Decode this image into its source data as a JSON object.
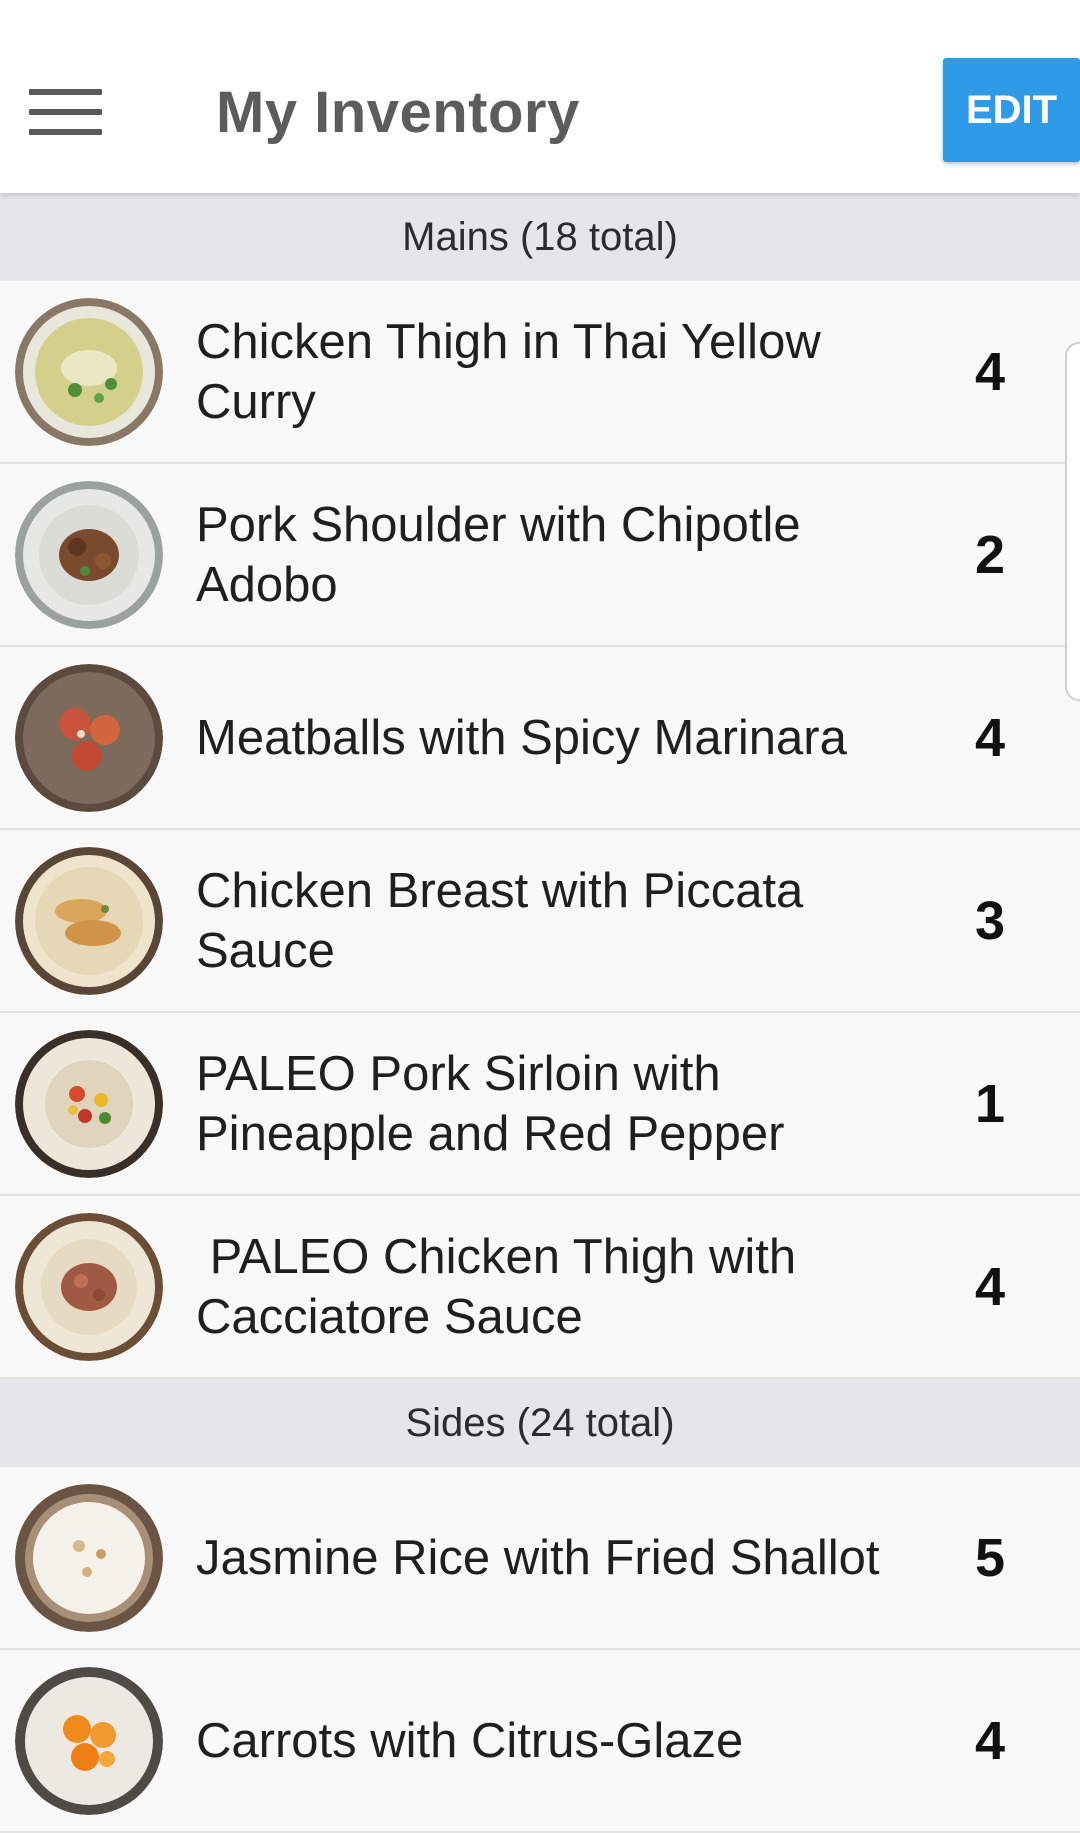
{
  "header": {
    "title": "My Inventory",
    "edit_label": "EDIT",
    "menu_icon": "hamburger-menu-icon"
  },
  "colors": {
    "accent": "#2d9be8",
    "section_bg": "#e5e6ea",
    "row_bg": "#f8f8f8"
  },
  "sections": [
    {
      "label": "Mains (18 total)",
      "items": [
        {
          "name": "Chicken Thigh in Thai Yellow\nCurry",
          "count": "4"
        },
        {
          "name": "Pork Shoulder with Chipotle\nAdobo",
          "count": "2"
        },
        {
          "name": "Meatballs with Spicy Marinara",
          "count": "4"
        },
        {
          "name": "Chicken Breast with Piccata\nSauce",
          "count": "3"
        },
        {
          "name": "PALEO Pork Sirloin with\nPineapple and Red Pepper",
          "count": "1"
        },
        {
          "name": " PALEO Chicken Thigh with\nCacciatore Sauce",
          "count": "4"
        }
      ]
    },
    {
      "label": "Sides (24 total)",
      "items": [
        {
          "name": "Jasmine Rice with Fried Shallot",
          "count": "5"
        },
        {
          "name": "Carrots with Citrus-Glaze",
          "count": "4"
        }
      ]
    }
  ]
}
